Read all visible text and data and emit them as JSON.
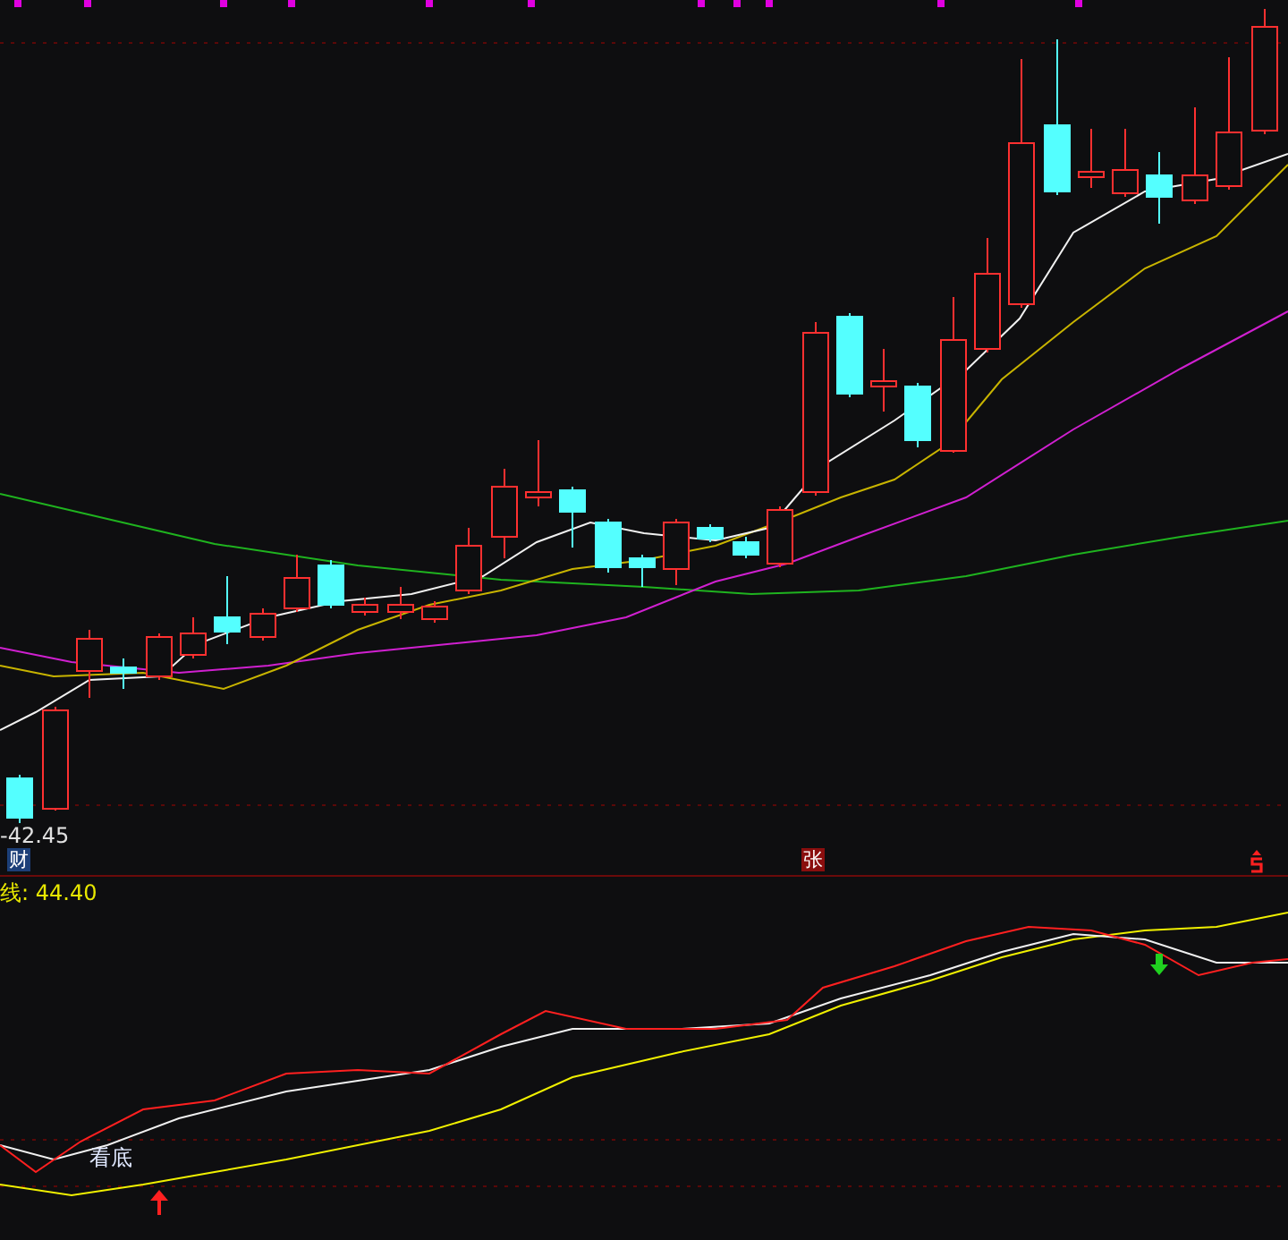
{
  "price_panel": {
    "price_label": "-42.45",
    "dollar_signal": true,
    "markers": [
      {
        "text": "财",
        "color": "#1c3f78"
      },
      {
        "text": "张",
        "color": "#8a0e0e"
      }
    ]
  },
  "indicator_panel": {
    "value_label": "线: 44.40",
    "signal_label": "看底"
  }
}
